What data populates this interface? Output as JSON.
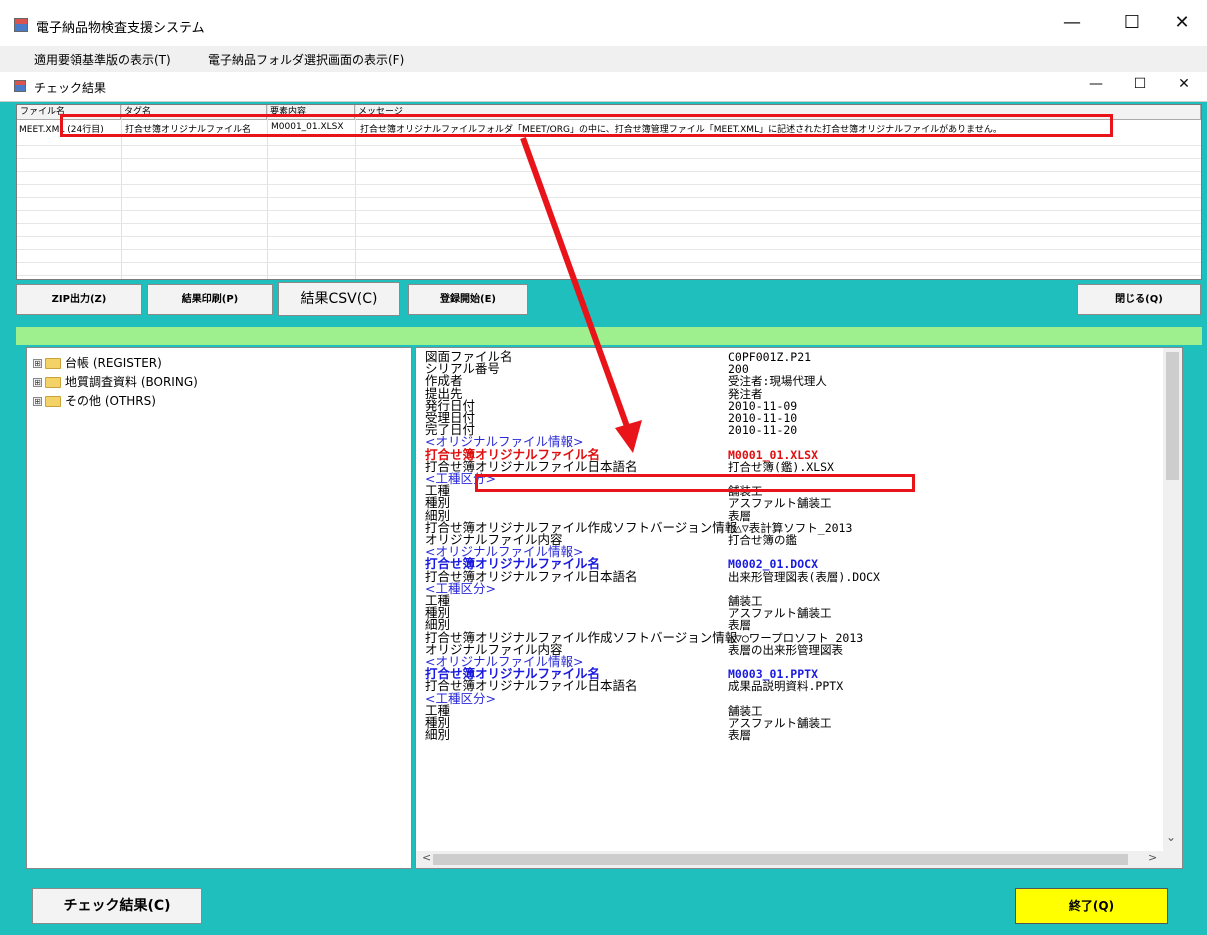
{
  "window": {
    "title": "電子納品物検査支援システム",
    "minimize": "—",
    "maximize": "☐",
    "close": "✕"
  },
  "menu": [
    "適用要領基準版の表示(T)",
    "電子納品フォルダ選択画面の表示(F)"
  ],
  "child_window": {
    "title": "チェック結果",
    "minimize": "—",
    "maximize": "☐",
    "close": "✕"
  },
  "results": {
    "columns": [
      "ファイル名",
      "タグ名",
      "要素内容",
      "メッセージ"
    ],
    "row": {
      "file": "MEET.XML (24行目)",
      "tag": "打合せ簿オリジナルファイル名",
      "value": "M0001_01.XLSX",
      "message": "打合せ簿オリジナルファイルフォルダ「MEET/ORG」の中に、打合せ簿管理ファイル「MEET.XML」に記述された打合せ簿オリジナルファイルがありません。"
    }
  },
  "buttons": {
    "zip": "ZIP出力(Z)",
    "print": "結果印刷(P)",
    "csv": "結果CSV(C)",
    "register": "登録開始(E)",
    "close": "閉じる(Q)",
    "check_results": "チェック結果(C)",
    "exit": "終了(Q)"
  },
  "tree": [
    {
      "label": "台帳 (REGISTER)",
      "expander": "⊞"
    },
    {
      "label": "地質調査資料 (BORING)",
      "expander": "⊞"
    },
    {
      "label": "その他 (OTHRS)",
      "expander": "⊞"
    }
  ],
  "details": [
    {
      "k": "図面ファイル名",
      "v": "C0PF001Z.P21",
      "style": ""
    },
    {
      "k": "シリアル番号",
      "v": "200",
      "style": ""
    },
    {
      "k": "作成者",
      "v": "受注者:現場代理人",
      "style": ""
    },
    {
      "k": "提出先",
      "v": "発注者",
      "style": ""
    },
    {
      "k": "発行日付",
      "v": "2010-11-09",
      "style": ""
    },
    {
      "k": "受理日付",
      "v": "2010-11-10",
      "style": ""
    },
    {
      "k": "完了日付",
      "v": "2010-11-20",
      "style": ""
    },
    {
      "k": "<オリジナルファイル情報>",
      "v": "",
      "style": "blue"
    },
    {
      "k": "打合せ簿オリジナルファイル名",
      "v": "M0001_01.XLSX",
      "style": "red"
    },
    {
      "k": "打合せ簿オリジナルファイル日本語名",
      "v": "打合せ簿(鑑).XLSX",
      "style": ""
    },
    {
      "k": "<工種区分>",
      "v": "",
      "style": "blue"
    },
    {
      "k": "工種",
      "v": "舗装工",
      "style": ""
    },
    {
      "k": "種別",
      "v": "アスファルト舗装工",
      "style": ""
    },
    {
      "k": "細別",
      "v": "表層",
      "style": ""
    },
    {
      "k": "打合せ簿オリジナルファイル作成ソフトバージョン情報",
      "v": "□△▽表計算ソフト_2013",
      "style": ""
    },
    {
      "k": "オリジナルファイル内容",
      "v": "打合せ簿の鑑",
      "style": ""
    },
    {
      "k": "<オリジナルファイル情報>",
      "v": "",
      "style": "blue"
    },
    {
      "k": "打合せ簿オリジナルファイル名",
      "v": "M0002_01.DOCX",
      "style": "bold-blue"
    },
    {
      "k": "打合せ簿オリジナルファイル日本語名",
      "v": "出来形管理図表(表層).DOCX",
      "style": ""
    },
    {
      "k": "<工種区分>",
      "v": "",
      "style": "blue"
    },
    {
      "k": "工種",
      "v": "舗装工",
      "style": ""
    },
    {
      "k": "種別",
      "v": "アスファルト舗装工",
      "style": ""
    },
    {
      "k": "細別",
      "v": "表層",
      "style": ""
    },
    {
      "k": "打合せ簿オリジナルファイル作成ソフトバージョン情報",
      "v": "△▽○ワープロソフト_2013",
      "style": ""
    },
    {
      "k": "オリジナルファイル内容",
      "v": "表層の出来形管理図表",
      "style": ""
    },
    {
      "k": "<オリジナルファイル情報>",
      "v": "",
      "style": "blue"
    },
    {
      "k": "打合せ簿オリジナルファイル名",
      "v": "M0003_01.PPTX",
      "style": "bold-blue"
    },
    {
      "k": "打合せ簿オリジナルファイル日本語名",
      "v": "成果品説明資料.PPTX",
      "style": ""
    },
    {
      "k": "<工種区分>",
      "v": "",
      "style": "blue"
    },
    {
      "k": "工種",
      "v": "舗装工",
      "style": ""
    },
    {
      "k": "種別",
      "v": "アスファルト舗装工",
      "style": ""
    },
    {
      "k": "細別",
      "v": "表層",
      "style": ""
    }
  ],
  "scroll": {
    "up": "⌃",
    "down": "⌄",
    "left": "<",
    "right": ">"
  },
  "colors": {
    "frame": "#1fbfbe",
    "status_bar": "#9ef08e",
    "highlight": "#e8141a",
    "exit_button": "#ffff00"
  }
}
